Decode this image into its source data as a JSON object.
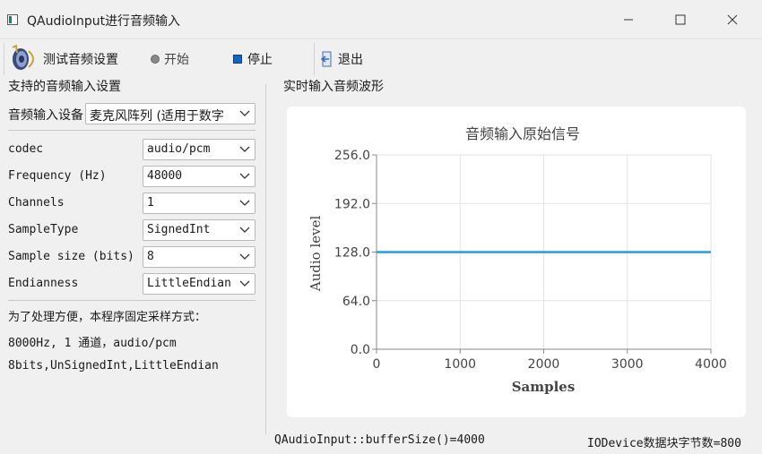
{
  "window": {
    "title": "QAudioInput进行音频输入"
  },
  "toolbar": {
    "test_label": "测试音频设置",
    "start_label": "开始",
    "stop_label": "停止",
    "exit_label": "退出"
  },
  "left": {
    "group_title": "支持的音频输入设置",
    "device_label": "音频输入设备",
    "device_value": "麦克风阵列 (适用于数字",
    "codec_label": "codec",
    "codec_value": "audio/pcm",
    "freq_label": "Frequency (Hz)",
    "freq_value": "48000",
    "channels_label": "Channels",
    "channels_value": "1",
    "sampletype_label": "SampleType",
    "sampletype_value": "SignedInt",
    "samplesize_label": "Sample size (bits)",
    "samplesize_value": "8",
    "endian_label": "Endianness",
    "endian_value": "LittleEndian",
    "info_line1": "为了处理方便，本程序固定采样方式：",
    "info_line2": "8000Hz, 1 通道，audio/pcm",
    "info_line3": "8bits,UnSignedInt,LittleEndian"
  },
  "right": {
    "group_title": "实时输入音频波形"
  },
  "status": {
    "left": "QAudioInput::bufferSize()=4000",
    "right": "IODevice数据块字节数=800"
  },
  "colors": {
    "series": "#209fdf",
    "chart_bg": "#ffffff",
    "stop_icon": "#1565c0"
  },
  "chart_data": {
    "type": "line",
    "title": "音频输入原始信号",
    "xlabel": "Samples",
    "ylabel": "Audio level",
    "xlim": [
      0,
      4000
    ],
    "ylim": [
      0,
      256
    ],
    "xticks": [
      "0",
      "1000",
      "2000",
      "3000",
      "4000"
    ],
    "yticks": [
      "0.0",
      "64.0",
      "128.0",
      "192.0",
      "256.0"
    ],
    "grid": true,
    "series": [
      {
        "x": [
          0,
          4000
        ],
        "y": [
          128,
          128
        ]
      }
    ]
  }
}
